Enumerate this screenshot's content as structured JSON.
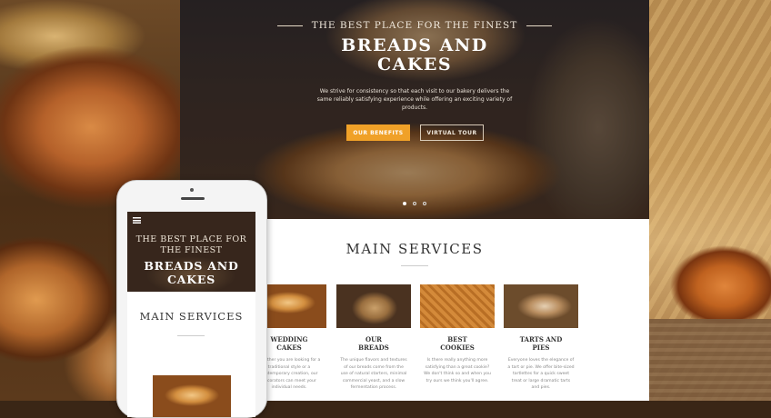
{
  "hero": {
    "subtitle": "THE BEST PLACE FOR THE FINEST",
    "title_line1": "BREADS AND",
    "title_line2": "CAKES",
    "text": "We strive for consistency so that each visit to our bakery delivers the same reliably satisfying experience while offering an exciting variety of products.",
    "primary_button": "OUR BENEFITS",
    "secondary_button": "VIRTUAL TOUR",
    "slides": 3,
    "active_slide": 1
  },
  "services": {
    "title": "MAIN SERVICES",
    "items": [
      {
        "line1": "WEDDING",
        "line2": "CAKES",
        "desc": "Whether you are looking for a traditional style or a contemporary creation, our decorators can meet your individual needs."
      },
      {
        "line1": "OUR",
        "line2": "BREADS",
        "desc": "The unique flavors and textures of our breads come from the use of natural starters, minimal commercial yeast, and a slow fermentation process."
      },
      {
        "line1": "BEST",
        "line2": "COOKIES",
        "desc": "Is there really anything more satisfying than a great cookie? We don't think so and when you try ours we think you'll agree."
      },
      {
        "line1": "TARTS AND",
        "line2": "PIES",
        "desc": "Everyone loves the elegance of a tart or pie. We offer bite-sized tartlettes for a quick sweet treat or large dramatic tarts and pies."
      }
    ]
  },
  "phone": {
    "subtitle_line1": "THE BEST PLACE FOR",
    "subtitle_line2": "THE FINEST",
    "title_line1": "BREADS AND",
    "title_line2": "CAKES",
    "services_title": "MAIN SERVICES"
  },
  "colors": {
    "accent": "#f0a128",
    "text_dark": "#333333"
  },
  "icons": {
    "menu": "hamburger-menu-icon"
  }
}
